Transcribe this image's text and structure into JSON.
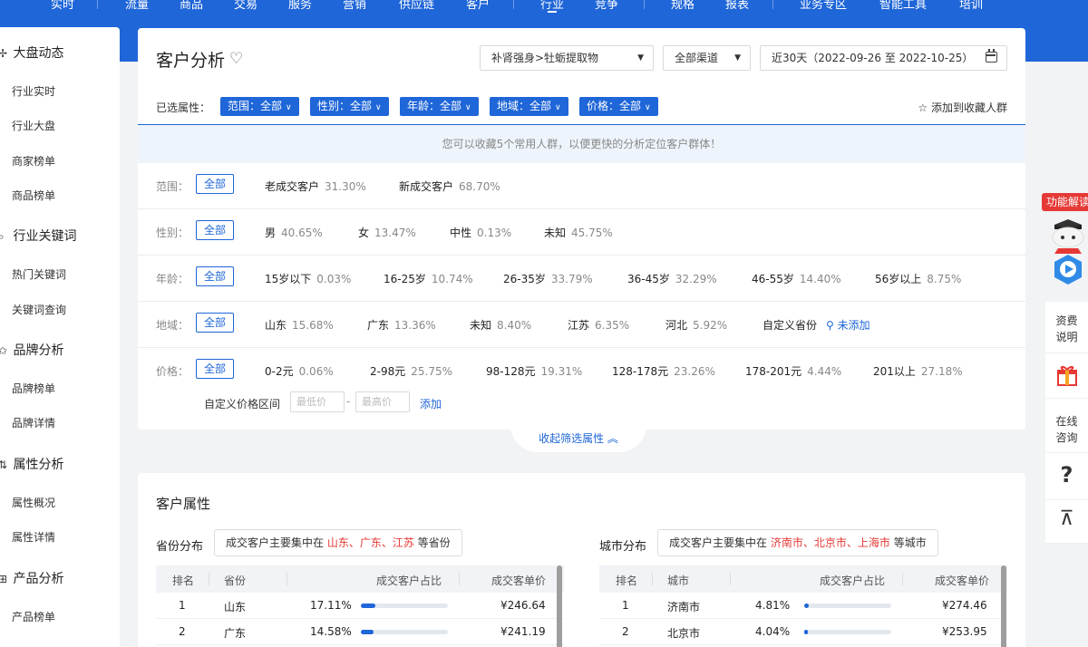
{
  "top_nav": {
    "items": [
      "实时",
      "流量",
      "商品",
      "交易",
      "服务",
      "营销",
      "供应链",
      "客户",
      "行业",
      "竞争",
      "规格",
      "报表",
      "业务专区",
      "智能工具",
      "培训"
    ]
  },
  "sidebar": {
    "groups": [
      {
        "label": "大盘动态",
        "items": [
          "行业实时",
          "行业大盘",
          "商家榜单",
          "商品榜单"
        ]
      },
      {
        "label": "行业关键词",
        "items": [
          "热门关键词",
          "关键词查询"
        ]
      },
      {
        "label": "品牌分析",
        "items": [
          "品牌榜单",
          "品牌详情"
        ]
      },
      {
        "label": "属性分析",
        "items": [
          "属性概况",
          "属性详情"
        ]
      },
      {
        "label": "产品分析",
        "items": [
          "产品榜单"
        ]
      }
    ]
  },
  "header": {
    "title": "客户分析",
    "category_select": "补肾强身>牡蛎提取物",
    "channel_select": "全部渠道",
    "date_range": "近30天（2022-09-26 至 2022-10-25）"
  },
  "selected_attrs": {
    "label": "已选属性：",
    "chips": [
      "范围：全部",
      "性别：全部",
      "年龄：全部",
      "地域：全部",
      "价格：全部"
    ],
    "add_favorite": "添加到收藏人群"
  },
  "notice": "您可以收藏5个常用人群，以便更快的分析定位客户群体！",
  "filters": {
    "all_label": "全部",
    "rows": [
      {
        "label": "范围：",
        "options": [
          {
            "name": "老成交客户",
            "pct": "31.30%"
          },
          {
            "name": "新成交客户",
            "pct": "68.70%"
          }
        ]
      },
      {
        "label": "性别：",
        "options": [
          {
            "name": "男",
            "pct": "40.65%"
          },
          {
            "name": "女",
            "pct": "13.47%"
          },
          {
            "name": "中性",
            "pct": "0.13%"
          },
          {
            "name": "未知",
            "pct": "45.75%"
          }
        ]
      },
      {
        "label": "年龄：",
        "options": [
          {
            "name": "15岁以下",
            "pct": "0.03%"
          },
          {
            "name": "16-25岁",
            "pct": "10.74%"
          },
          {
            "name": "26-35岁",
            "pct": "33.79%"
          },
          {
            "name": "36-45岁",
            "pct": "32.29%"
          },
          {
            "name": "46-55岁",
            "pct": "14.40%"
          },
          {
            "name": "56岁以上",
            "pct": "8.75%"
          }
        ]
      },
      {
        "label": "地域：",
        "options": [
          {
            "name": "山东",
            "pct": "15.68%"
          },
          {
            "name": "广东",
            "pct": "13.36%"
          },
          {
            "name": "未知",
            "pct": "8.40%"
          },
          {
            "name": "江苏",
            "pct": "6.35%"
          },
          {
            "name": "河北",
            "pct": "5.92%"
          },
          {
            "name": "自定义省份",
            "pct": ""
          }
        ],
        "link": "未添加"
      },
      {
        "label": "价格：",
        "options": [
          {
            "name": "0-2元",
            "pct": "0.06%"
          },
          {
            "name": "2-98元",
            "pct": "25.75%"
          },
          {
            "name": "98-128元",
            "pct": "19.31%"
          },
          {
            "name": "128-178元",
            "pct": "23.26%"
          },
          {
            "name": "178-201元",
            "pct": "4.44%"
          },
          {
            "name": "201以上",
            "pct": "27.18%"
          }
        ]
      }
    ],
    "custom_price_label": "自定义价格区间",
    "min_placeholder": "最低价",
    "max_placeholder": "最高价",
    "add_label": "添加",
    "collapse_label": "收起筛选属性"
  },
  "customer_attrs": {
    "title": "客户属性",
    "province": {
      "title": "省份分布",
      "summary_prefix": "成交客户主要集中在",
      "summary_highlight": "山东、广东、江苏",
      "summary_suffix": "等省份",
      "columns": [
        "排名",
        "省份",
        "成交客户占比",
        "成交客单价"
      ],
      "rows": [
        {
          "rank": "1",
          "name": "山东",
          "pct": "17.11%",
          "ratio": 0.1711,
          "price": "¥246.64"
        },
        {
          "rank": "2",
          "name": "广东",
          "pct": "14.58%",
          "ratio": 0.1458,
          "price": "¥241.19"
        }
      ]
    },
    "city": {
      "title": "城市分布",
      "summary_prefix": "成交客户主要集中在",
      "summary_highlight": "济南市、北京市、上海市",
      "summary_suffix": "等城市",
      "columns": [
        "排名",
        "城市",
        "成交客户占比",
        "成交客单价"
      ],
      "rows": [
        {
          "rank": "1",
          "name": "济南市",
          "pct": "4.81%",
          "ratio": 0.0481,
          "price": "¥274.46"
        },
        {
          "rank": "2",
          "name": "北京市",
          "pct": "4.04%",
          "ratio": 0.0404,
          "price": "¥253.95"
        }
      ]
    }
  },
  "right_tools": {
    "feature_tag": "功能解读",
    "fee": "资费说明",
    "online": "在线咨询",
    "help": "?",
    "top": "⊼"
  },
  "colors": {
    "brand_blue": "#1f66d8",
    "highlight_red": "#e53935"
  }
}
